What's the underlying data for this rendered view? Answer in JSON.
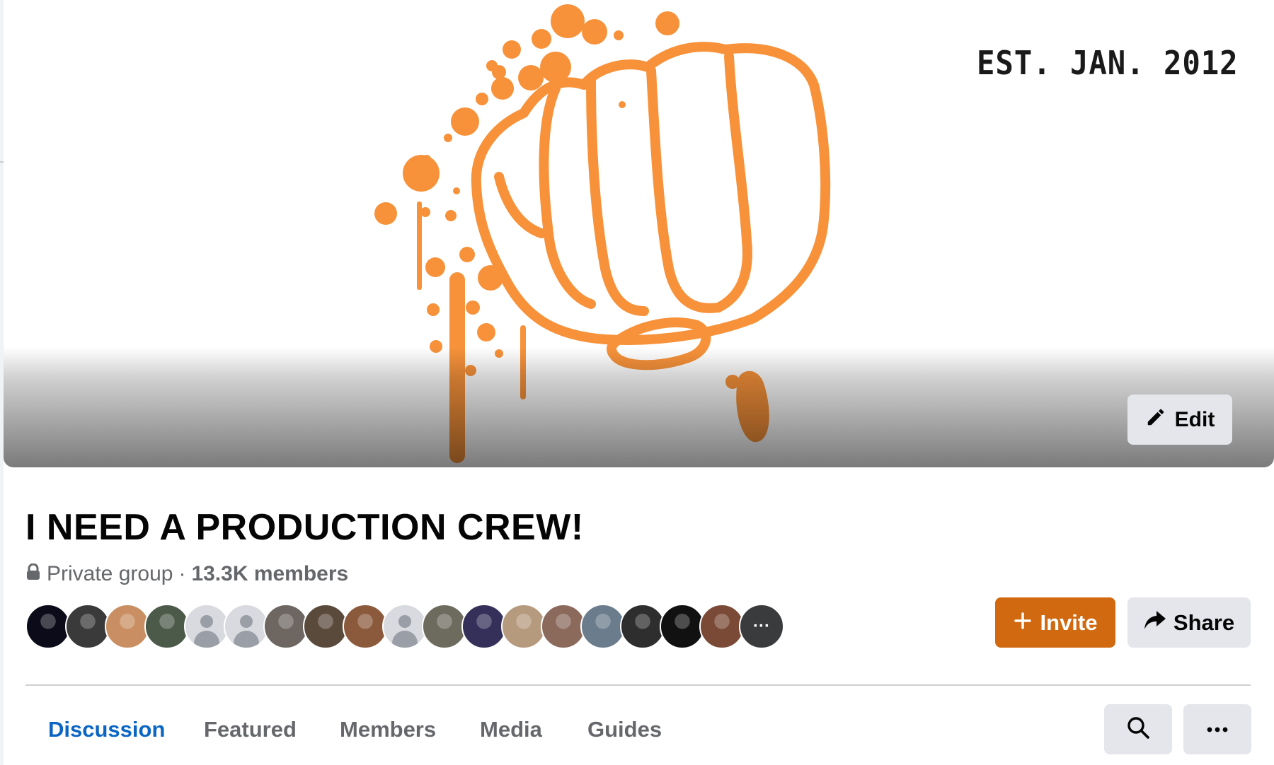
{
  "cover": {
    "est_text": "EST. JAN. 2012",
    "accent_color": "#f7923a",
    "edit_label": "Edit",
    "edit_icon": "pencil-icon"
  },
  "group": {
    "title": "I NEED A PRODUCTION CREW!",
    "privacy_icon": "lock-icon",
    "privacy_label": "Private group",
    "separator": " · ",
    "member_count": "13.3K members"
  },
  "avatars": {
    "items": [
      {
        "kind": "photo",
        "color": "#0b0b1a"
      },
      {
        "kind": "photo",
        "color": "#3a3a3a"
      },
      {
        "kind": "photo",
        "color": "#c98f62"
      },
      {
        "kind": "photo",
        "color": "#4c5a4a"
      },
      {
        "kind": "default"
      },
      {
        "kind": "default"
      },
      {
        "kind": "photo",
        "color": "#6e6660"
      },
      {
        "kind": "photo",
        "color": "#5a4a3c"
      },
      {
        "kind": "photo",
        "color": "#8b5a3c"
      },
      {
        "kind": "default"
      },
      {
        "kind": "photo",
        "color": "#6d6b5e"
      },
      {
        "kind": "photo",
        "color": "#34305a"
      },
      {
        "kind": "photo",
        "color": "#b59a7e"
      },
      {
        "kind": "photo",
        "color": "#8b6a5c"
      },
      {
        "kind": "photo",
        "color": "#6b7c8c"
      },
      {
        "kind": "photo",
        "color": "#2e2e2e"
      },
      {
        "kind": "photo",
        "color": "#111111"
      },
      {
        "kind": "photo",
        "color": "#7a4a36"
      }
    ],
    "more_label": "···"
  },
  "actions": {
    "invite_label": "Invite",
    "invite_icon": "plus-icon",
    "share_label": "Share",
    "share_icon": "share-arrow-icon",
    "invite_color": "#d0690f"
  },
  "tabs": [
    {
      "label": "Discussion",
      "active": true
    },
    {
      "label": "Featured",
      "active": false
    },
    {
      "label": "Members",
      "active": false
    },
    {
      "label": "Media",
      "active": false
    },
    {
      "label": "Guides",
      "active": false
    }
  ],
  "toolbar": {
    "search_icon": "search-icon",
    "more_icon": "more-horizontal-icon"
  }
}
